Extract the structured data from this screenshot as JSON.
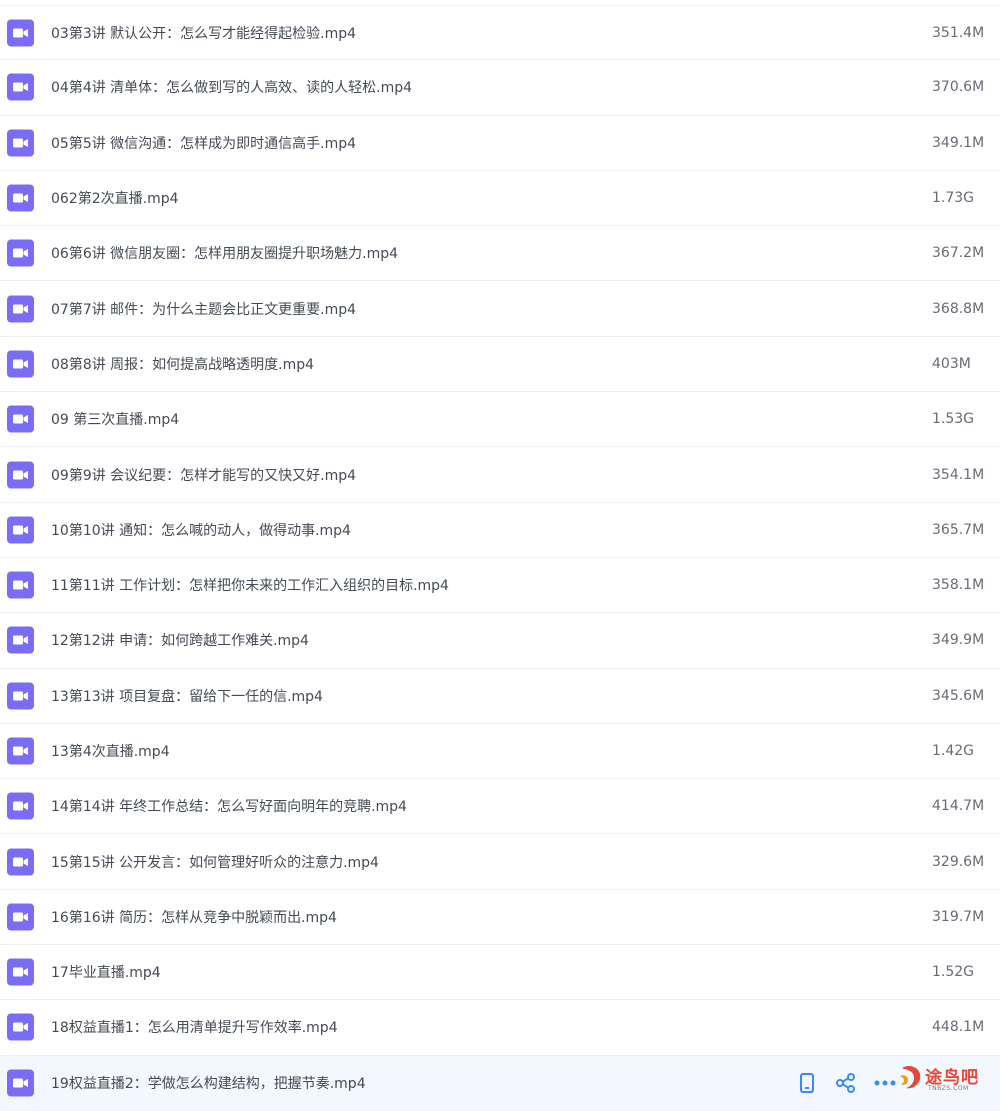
{
  "files": [
    {
      "name": "03第3讲 默认公开：怎么写才能经得起检验.mp4",
      "size": "351.4M"
    },
    {
      "name": "04第4讲 清单体：怎么做到写的人高效、读的人轻松.mp4",
      "size": "370.6M"
    },
    {
      "name": "05第5讲 微信沟通：怎样成为即时通信高手.mp4",
      "size": "349.1M"
    },
    {
      "name": "062第2次直播.mp4",
      "size": "1.73G"
    },
    {
      "name": "06第6讲 微信朋友圈：怎样用朋友圈提升职场魅力.mp4",
      "size": "367.2M"
    },
    {
      "name": "07第7讲 邮件：为什么主题会比正文更重要.mp4",
      "size": "368.8M"
    },
    {
      "name": "08第8讲 周报：如何提高战略透明度.mp4",
      "size": "403M"
    },
    {
      "name": "09 第三次直播.mp4",
      "size": "1.53G"
    },
    {
      "name": "09第9讲 会议纪要：怎样才能写的又快又好.mp4",
      "size": "354.1M"
    },
    {
      "name": "10第10讲 通知：怎么喊的动人，做得动事.mp4",
      "size": "365.7M"
    },
    {
      "name": "11第11讲 工作计划：怎样把你未来的工作汇入组织的目标.mp4",
      "size": "358.1M"
    },
    {
      "name": "12第12讲 申请：如何跨越工作难关.mp4",
      "size": "349.9M"
    },
    {
      "name": "13第13讲 项目复盘：留给下一任的信.mp4",
      "size": "345.6M"
    },
    {
      "name": "13第4次直播.mp4",
      "size": "1.42G"
    },
    {
      "name": "14第14讲 年终工作总结：怎么写好面向明年的竞聘.mp4",
      "size": "414.7M"
    },
    {
      "name": "15第15讲 公开发言：如何管理好听众的注意力.mp4",
      "size": "329.6M"
    },
    {
      "name": "16第16讲 简历：怎样从竞争中脱颖而出.mp4",
      "size": "319.7M"
    },
    {
      "name": "17毕业直播.mp4",
      "size": "1.52G"
    },
    {
      "name": "18权益直播1：怎么用清单提升写作效率.mp4",
      "size": "448.1M"
    },
    {
      "name": "19权益直播2：学做怎么构建结构，把握节奏.mp4",
      "size": ""
    }
  ],
  "row_actions": [
    {
      "icon": "phone-icon"
    },
    {
      "icon": "share-icon"
    },
    {
      "icon": "more-icon"
    }
  ],
  "watermark": {
    "text": "途鸟吧",
    "subtext": "TNBZS.COM"
  },
  "colors": {
    "video_icon": "#7b6cf6",
    "action_icon": "#3a8af5",
    "row_hover": "#f3f8ff"
  }
}
